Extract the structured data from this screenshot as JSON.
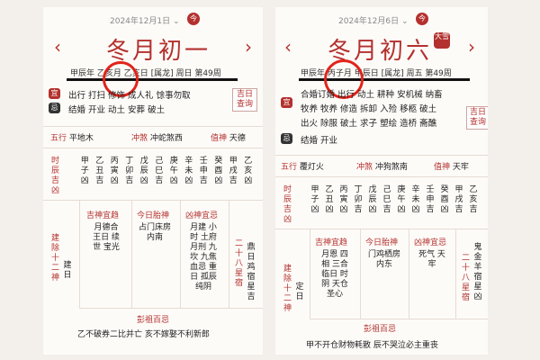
{
  "left": {
    "date_label": "2024年12月1日",
    "today_label": "今",
    "lunar_day": "冬月初一",
    "ganzhi": "甲辰年 乙亥月 乙亥日 [属龙] 周日 第49周",
    "yi_badge": "宜",
    "yi": "出行 打扫 修饰 成人礼 馀事勿取",
    "ji_badge": "忌",
    "ji": "结婚 开业 动土 安葬 破土",
    "query": "吉日查询",
    "wuxing_label": "五行",
    "wuxing": "平地木",
    "chong_label": "冲煞",
    "chong": "冲蛇煞西",
    "zhishen_label": "值神",
    "zhishen": "天德",
    "shichen_label": "时辰吉凶",
    "hours": [
      [
        "甲",
        "子",
        "凶"
      ],
      [
        "乙",
        "丑",
        "吉"
      ],
      [
        "丙",
        "寅",
        "凶"
      ],
      [
        "丁",
        "卯",
        "吉"
      ],
      [
        "戊",
        "辰",
        "凶"
      ],
      [
        "己",
        "巳",
        "吉"
      ],
      [
        "庚",
        "午",
        "凶"
      ],
      [
        "辛",
        "未",
        "凶"
      ],
      [
        "壬",
        "申",
        "吉"
      ],
      [
        "癸",
        "酉",
        "凶"
      ],
      [
        "甲",
        "戌",
        "吉"
      ],
      [
        "乙",
        "亥",
        "凶"
      ]
    ],
    "jianchu_label": "建除十二神",
    "jianchu": "建日",
    "jishen_title": "吉神宜趋",
    "jishen": [
      "月德合",
      "王日 续",
      "世 宝光"
    ],
    "taishen_title": "今日胎神",
    "taishen": [
      "占门床房",
      "内南"
    ],
    "xiongshen_title": "凶神宜忌",
    "xiongshen": [
      "月建 小",
      "时 土府",
      "月刑 九",
      "坎 九焦",
      "血忌 重",
      "日 孤辰",
      "纯阴"
    ],
    "xiu_label": "二十八星宿",
    "xiu": [
      "鼎日",
      "鸡宿星",
      "吉"
    ],
    "pengzu_title": "彭祖百忌",
    "pengzu": "乙不破券二比并亡 亥不嫁娶不利新郎"
  },
  "right": {
    "date_label": "2024年12月6日",
    "today_label": "今",
    "lunar_day": "冬月初六",
    "seal": "大雪",
    "ganzhi": "甲辰年 丙子月 甲辰日 [属龙] 周五 第49周",
    "yi_badge": "宜",
    "yi_lines": [
      "合婚订婚 出行 动土 耕种 安机械 纳畜",
      "牧养 牧养 修造 拆卸 入殓 移柩 破土",
      "出火 除服 破土 求子 塑绘 造桥 斋醮"
    ],
    "ji_badge": "忌",
    "ji": "结婚 开业",
    "query": "吉日查询",
    "wuxing_label": "五行",
    "wuxing": "覆灯火",
    "chong_label": "冲煞",
    "chong": "冲狗煞南",
    "zhishen_label": "值神",
    "zhishen": "天牢",
    "shichen_label": "时辰吉凶",
    "hours": [
      [
        "甲",
        "子",
        "凶"
      ],
      [
        "乙",
        "丑",
        "凶"
      ],
      [
        "丙",
        "寅",
        "凶"
      ],
      [
        "丁",
        "卯",
        "吉"
      ],
      [
        "戊",
        "辰",
        "凶"
      ],
      [
        "己",
        "巳",
        "吉"
      ],
      [
        "庚",
        "午",
        "凶"
      ],
      [
        "辛",
        "未",
        "凶"
      ],
      [
        "壬",
        "申",
        "吉"
      ],
      [
        "癸",
        "酉",
        "凶"
      ],
      [
        "甲",
        "戌",
        "吉"
      ],
      [
        "乙",
        "亥",
        "吉"
      ]
    ],
    "jianchu_label": "建除十二神",
    "jianchu": "定日",
    "jishen_title": "吉神宜趋",
    "jishen": [
      "月恩 四",
      "相 三合",
      "临日 时",
      "阴 天仓",
      "圣心"
    ],
    "taishen_title": "今日胎神",
    "taishen": [
      "门鸡栖房",
      "内东"
    ],
    "xiongshen_title": "凶神宜忌",
    "xiongshen": [
      "死气 天",
      "牢"
    ],
    "xiu_label": "二十八星宿",
    "xiu": [
      "鬼",
      "金羊宿星",
      "凶"
    ],
    "pengzu_title": "彭祖百忌",
    "pengzu": "甲不开仓财物耗散 辰不哭泣必主重丧"
  }
}
